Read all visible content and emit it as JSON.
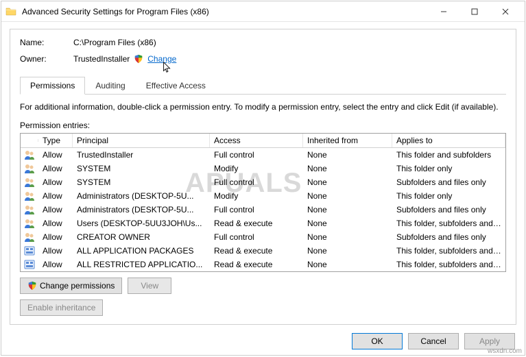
{
  "window": {
    "title": "Advanced Security Settings for Program Files (x86)"
  },
  "info": {
    "name_label": "Name:",
    "name_value": "C:\\Program Files (x86)",
    "owner_label": "Owner:",
    "owner_value": "TrustedInstaller",
    "change_link": "Change"
  },
  "tabs": {
    "permissions": "Permissions",
    "auditing": "Auditing",
    "effective": "Effective Access"
  },
  "text": {
    "instructions": "For additional information, double-click a permission entry. To modify a permission entry, select the entry and click Edit (if available).",
    "entries_label": "Permission entries:"
  },
  "columns": {
    "type": "Type",
    "principal": "Principal",
    "access": "Access",
    "inherited": "Inherited from",
    "applies": "Applies to"
  },
  "rows": [
    {
      "icon": "people",
      "type": "Allow",
      "principal": "TrustedInstaller",
      "access": "Full control",
      "inherited": "None",
      "applies": "This folder and subfolders"
    },
    {
      "icon": "people",
      "type": "Allow",
      "principal": "SYSTEM",
      "access": "Modify",
      "inherited": "None",
      "applies": "This folder only"
    },
    {
      "icon": "people",
      "type": "Allow",
      "principal": "SYSTEM",
      "access": "Full control",
      "inherited": "None",
      "applies": "Subfolders and files only"
    },
    {
      "icon": "people",
      "type": "Allow",
      "principal": "Administrators (DESKTOP-5U...",
      "access": "Modify",
      "inherited": "None",
      "applies": "This folder only"
    },
    {
      "icon": "people",
      "type": "Allow",
      "principal": "Administrators (DESKTOP-5U...",
      "access": "Full control",
      "inherited": "None",
      "applies": "Subfolders and files only"
    },
    {
      "icon": "people",
      "type": "Allow",
      "principal": "Users (DESKTOP-5UU3JOH\\Us...",
      "access": "Read & execute",
      "inherited": "None",
      "applies": "This folder, subfolders and files"
    },
    {
      "icon": "people",
      "type": "Allow",
      "principal": "CREATOR OWNER",
      "access": "Full control",
      "inherited": "None",
      "applies": "Subfolders and files only"
    },
    {
      "icon": "pkg",
      "type": "Allow",
      "principal": "ALL APPLICATION PACKAGES",
      "access": "Read & execute",
      "inherited": "None",
      "applies": "This folder, subfolders and files"
    },
    {
      "icon": "pkg",
      "type": "Allow",
      "principal": "ALL RESTRICTED APPLICATIO...",
      "access": "Read & execute",
      "inherited": "None",
      "applies": "This folder, subfolders and files"
    }
  ],
  "buttons": {
    "change_perms": "Change permissions",
    "view": "View",
    "enable_inh": "Enable inheritance",
    "ok": "OK",
    "cancel": "Cancel",
    "apply": "Apply"
  },
  "watermark": "PUALS",
  "source_mark": "wsxdn.com"
}
